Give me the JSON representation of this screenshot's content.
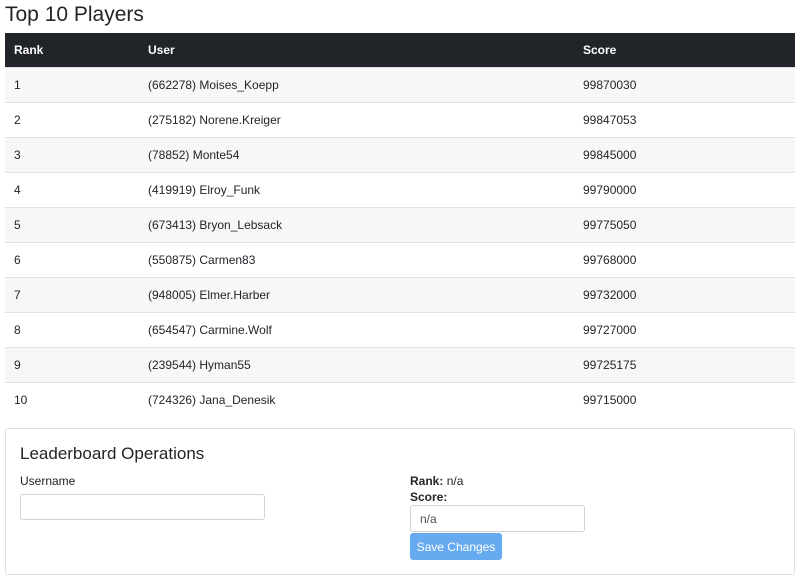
{
  "page": {
    "title": "Top 10 Players"
  },
  "table": {
    "headers": {
      "rank": "Rank",
      "user": "User",
      "score": "Score"
    },
    "rows": [
      {
        "rank": "1",
        "user": "(662278) Moises_Koepp",
        "score": "99870030"
      },
      {
        "rank": "2",
        "user": "(275182) Norene.Kreiger",
        "score": "99847053"
      },
      {
        "rank": "3",
        "user": "(78852) Monte54",
        "score": "99845000"
      },
      {
        "rank": "4",
        "user": "(419919) Elroy_Funk",
        "score": "99790000"
      },
      {
        "rank": "5",
        "user": "(673413) Bryon_Lebsack",
        "score": "99775050"
      },
      {
        "rank": "6",
        "user": "(550875) Carmen83",
        "score": "99768000"
      },
      {
        "rank": "7",
        "user": "(948005) Elmer.Harber",
        "score": "99732000"
      },
      {
        "rank": "8",
        "user": "(654547) Carmine.Wolf",
        "score": "99727000"
      },
      {
        "rank": "9",
        "user": "(239544) Hyman55",
        "score": "99725175"
      },
      {
        "rank": "10",
        "user": "(724326) Jana_Denesik",
        "score": "99715000"
      }
    ]
  },
  "operations": {
    "title": "Leaderboard Operations",
    "username_label": "Username",
    "username_value": "",
    "rank_label": "Rank:",
    "rank_value": "n/a",
    "score_label": "Score:",
    "score_value": "n/a",
    "save_label": "Save Changes",
    "save_button_color": "#66aaf0"
  },
  "colors": {
    "header_bg": "#212529",
    "header_text": "#ffffff",
    "stripe": "#f7f7f7"
  }
}
